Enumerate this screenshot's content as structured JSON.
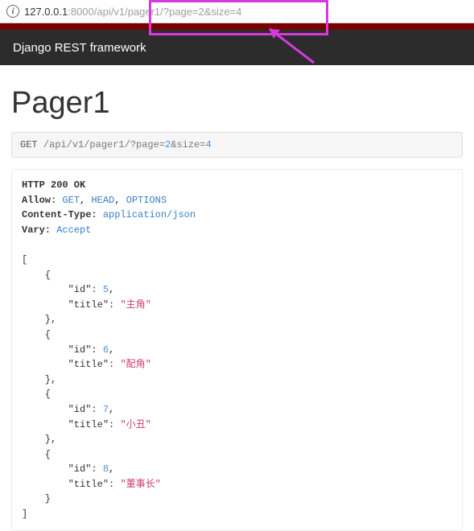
{
  "url": {
    "info_icon": "i",
    "host": "127.0.0.1",
    "port": ":8000",
    "path_prefix": "/api/v1/",
    "path_hl": "pager1/?page=",
    "pg_num": "2",
    "mid": "&size=",
    "sz_num": "4"
  },
  "header": {
    "brand": "Django REST framework"
  },
  "title": "Pager1",
  "request": {
    "method": "GET",
    "path": "/api/v1/pager1/?page=",
    "pg": "2",
    "mid": "&size=",
    "sz": "4"
  },
  "response": {
    "status": "HTTP 200 OK",
    "allow_label": "Allow:",
    "allow": [
      "GET",
      "HEAD",
      "OPTIONS"
    ],
    "ctype_label": "Content-Type:",
    "ctype": "application/json",
    "vary_label": "Vary:",
    "vary": "Accept"
  },
  "chart_data": {
    "type": "table",
    "columns": [
      "id",
      "title"
    ],
    "rows": [
      {
        "id": 5,
        "title": "主角"
      },
      {
        "id": 6,
        "title": "配角"
      },
      {
        "id": 7,
        "title": "小丑"
      },
      {
        "id": 8,
        "title": "董事长"
      }
    ]
  }
}
